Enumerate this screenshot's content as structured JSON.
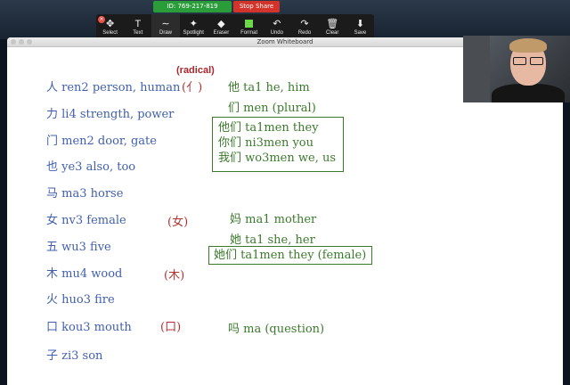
{
  "meeting": {
    "id_label": "ID: 769-217-819",
    "stop_share_label": "Stop Share"
  },
  "toolbar": {
    "tools": [
      {
        "key": "select",
        "label": "Select",
        "icon": "move-icon",
        "glyph": "✥"
      },
      {
        "key": "text",
        "label": "Text",
        "icon": "text-icon",
        "glyph": "T"
      },
      {
        "key": "draw",
        "label": "Draw",
        "icon": "draw-icon",
        "glyph": "∼",
        "active": true
      },
      {
        "key": "spotlight",
        "label": "Spotlight",
        "icon": "spotlight-icon",
        "glyph": "✦"
      },
      {
        "key": "eraser",
        "label": "Eraser",
        "icon": "eraser-icon",
        "glyph": "◆"
      },
      {
        "key": "format",
        "label": "Format",
        "icon": "format-icon",
        "glyph": "",
        "color": "#6cd94a"
      },
      {
        "key": "undo",
        "label": "Undo",
        "icon": "undo-icon",
        "glyph": "↶"
      },
      {
        "key": "redo",
        "label": "Redo",
        "icon": "redo-icon",
        "glyph": "↷"
      },
      {
        "key": "clear",
        "label": "Clear",
        "icon": "trash-icon",
        "glyph": "🗑"
      },
      {
        "key": "save",
        "label": "Save",
        "icon": "save-icon",
        "glyph": "⬇"
      }
    ]
  },
  "whiteboard": {
    "title": "Zoom Whiteboard",
    "radical_label": "(radical)",
    "vocab": [
      "人 ren2 person, human",
      "力 li4 strength, power",
      "门 men2 door, gate",
      "也 ye3 also, too",
      "马 ma3 horse",
      "女 nv3 female",
      "五 wu3 five",
      "木 mu4 wood",
      "火 huo3 fire",
      "口 kou3 mouth",
      "子 zi3 son"
    ],
    "radicals": [
      "(亻)",
      "(女)",
      "(木)",
      "(口)"
    ],
    "notes": {
      "ta1": "他 ta1 he, him",
      "men": "们 men (plural)",
      "box1": [
        "他们 ta1men they",
        "你们 ni3men you",
        "我们 wo3men we, us"
      ],
      "ma1": "妈 ma1 mother",
      "ta1_she": "她 ta1 she, her",
      "box2": "她们 ta1men they (female)",
      "ma": "吗 ma (question)"
    }
  },
  "colors": {
    "vocab": "#3f5fae",
    "radical": "#b03434",
    "notes": "#3b7a2c"
  }
}
